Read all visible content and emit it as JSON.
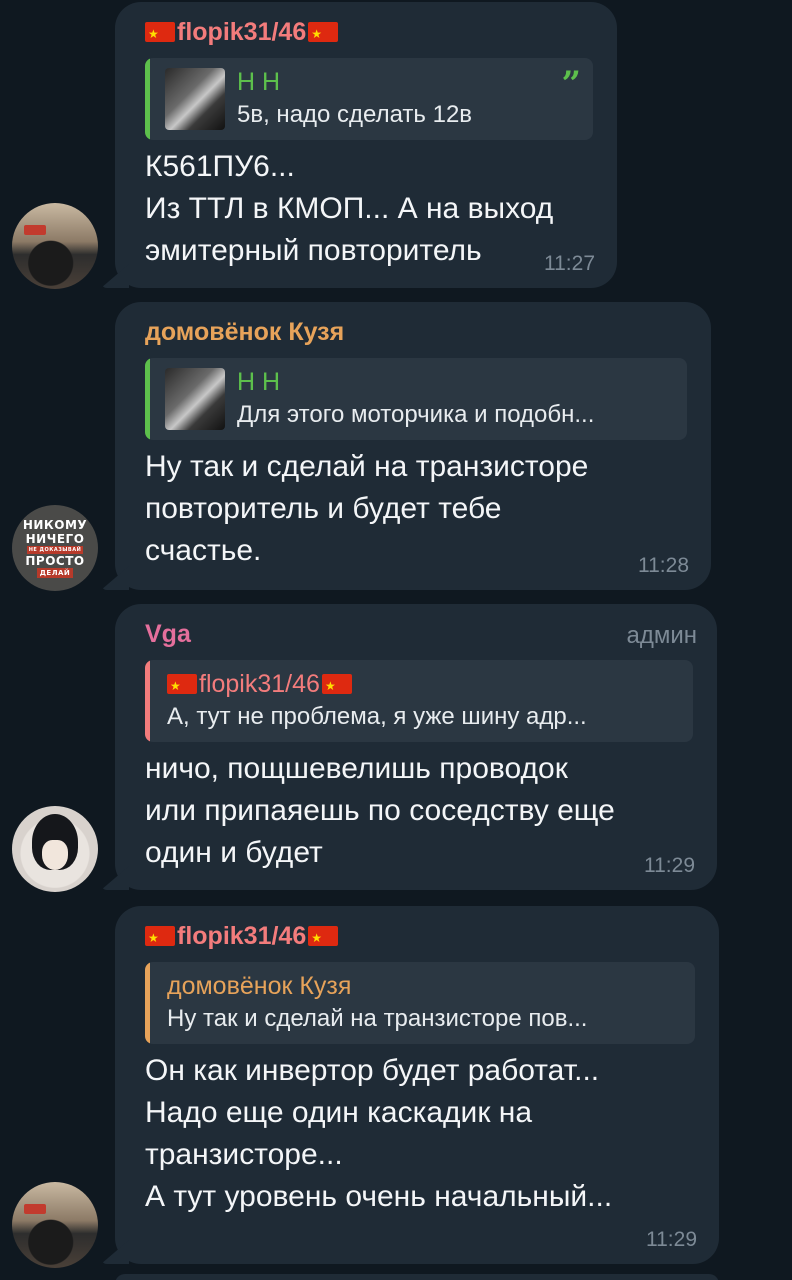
{
  "messages": [
    {
      "sender": "flopik31/46",
      "sender_color": "#f37c7c",
      "reply": {
        "name": "Н Н",
        "text": "5в, надо сделать 12в",
        "bar_color": "#5dc04c",
        "name_color": "#5dc04c"
      },
      "text": "К561ПУ6...\nИз ТТЛ в КМОП... А на выход\nэмитерный повторитель",
      "time": "11:27",
      "avatar": "car-interior-avatar"
    },
    {
      "sender": "домовёнок Кузя",
      "sender_color": "#e7a35a",
      "reply": {
        "name": "Н Н",
        "text": "Для этого моторчика и подобн...",
        "bar_color": "#5dc04c",
        "name_color": "#5dc04c"
      },
      "text": "Ну так и сделай на транзисторе\nповторитель и будет тебе\nсчастье.",
      "time": "11:28",
      "avatar": {
        "line1": "НИКОМУ",
        "line2": "НИЧЕГО",
        "line3": "НЕ ДОКАЗЫВАЙ",
        "line4": "ПРОСТО",
        "line5": "ДЕЛАЙ"
      }
    },
    {
      "sender": "Vga",
      "sender_color": "#e56f9c",
      "role": "админ",
      "reply": {
        "name": "flopik31/46",
        "text": "А, тут не проблема, я уже шину адр...",
        "bar_color": "#f37c7c",
        "name_color": "#f37c7c"
      },
      "text": "ничо, пощшевелишь проводок\nили припаяешь по соседству еще\nодин и будет",
      "time": "11:29",
      "avatar": "anime-avatar"
    },
    {
      "sender": "flopik31/46",
      "sender_color": "#f37c7c",
      "reply": {
        "name": "домовёнок Кузя",
        "text": "Ну так и сделай на транзисторе пов...",
        "bar_color": "#e7a35a",
        "name_color": "#e7a35a"
      },
      "text": "Он как инвертор будет работат...\nНадо еще один каскадик на\nтранзисторе...\nА тут уровень очень начальный...",
      "time": "11:29",
      "avatar": "car-interior-avatar"
    }
  ]
}
